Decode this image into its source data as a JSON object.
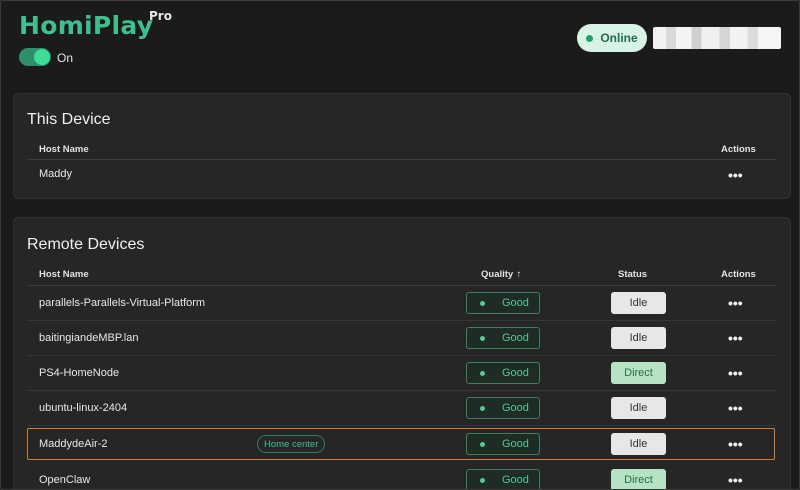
{
  "app": {
    "name": "HomiPlay",
    "edition": "Pro",
    "power_label": "On",
    "connection_status": "Online"
  },
  "this_device": {
    "title": "This Device",
    "columns": {
      "host": "Host Name",
      "actions": "Actions"
    },
    "rows": [
      {
        "host": "Maddy",
        "actions": "•••"
      }
    ]
  },
  "remote_devices": {
    "title": "Remote Devices",
    "columns": {
      "host": "Host Name",
      "quality": "Quality",
      "quality_sort": "↑",
      "status": "Status",
      "actions": "Actions"
    },
    "rows": [
      {
        "host": "parallels-Parallels-Virtual-Platform",
        "tag": "",
        "quality": "Good",
        "status": "Idle",
        "actions": "•••"
      },
      {
        "host": "baitingiandeMBP.lan",
        "tag": "",
        "quality": "Good",
        "status": "Idle",
        "actions": "•••"
      },
      {
        "host": "PS4-HomeNode",
        "tag": "",
        "quality": "Good",
        "status": "Direct",
        "actions": "•••"
      },
      {
        "host": "ubuntu-linux-2404",
        "tag": "",
        "quality": "Good",
        "status": "Idle",
        "actions": "•••"
      },
      {
        "host": "MaddydeAir-2",
        "tag": "Home center",
        "quality": "Good",
        "status": "Idle",
        "actions": "•••"
      },
      {
        "host": "OpenClaw",
        "tag": "",
        "quality": "Good",
        "status": "Direct",
        "actions": "•••"
      }
    ]
  },
  "colors": {
    "brand": "#3fbf8f",
    "online_bg": "#d8f3e6",
    "good": "#55c894",
    "idle_bg": "#e7e7e7",
    "direct_bg": "#b6e3c4",
    "selected_border": "#c9822a"
  }
}
